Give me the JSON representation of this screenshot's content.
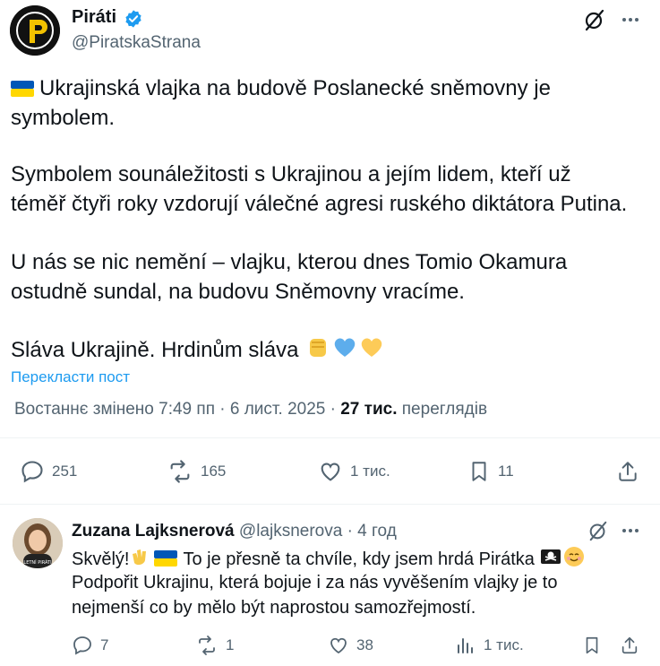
{
  "post": {
    "author_name": "Piráti",
    "author_handle": "@PiratskaStrana",
    "lines": [
      "Ukrajinská vlajka na budově Poslanecké sněmovny je",
      "symbolem.",
      "Symbolem sounáležitosti s Ukrajinou a jejím lidem, kteří už",
      "téměř čtyři roky vzdorují válečné agresi ruského diktátora Putina.",
      "U nás se nic nemění – vlajku, kterou dnes Tomio Okamura",
      "ostudně sundal, na budovu Sněmovny vracíme.",
      "Sláva Ukrajině. Hrdinům sláva"
    ],
    "translate_label": "Перекласти пост",
    "meta_prefix": "Востаннє змінено 7:49 пп · 6 лист. 2025 ·",
    "views_count": "27 тис.",
    "views_label": "переглядів",
    "actions": {
      "replies": "251",
      "reposts": "165",
      "likes": "1 тис.",
      "bookmarks": "11"
    }
  },
  "reply": {
    "author_name": "Zuzana Lajksnerová",
    "author_handle": "@lajksnerova · 4 год",
    "line1_a": "Skvělý!",
    "line1_b": "To je přesně ta chvíle, kdy jsem hrdá Pirátka",
    "line2": "Podpořit Ukrajinu, která bojuje i za nás vyvěšením vlajky je to",
    "line3": "nejmenší co by mělo být naprostou samozřejmostí.",
    "actions": {
      "replies": "7",
      "reposts": "1",
      "likes": "38",
      "views": "1 тис."
    }
  },
  "icons": {
    "verified": "verified-badge-icon",
    "grok": "grok-icon",
    "more": "more-icon",
    "reply": "reply-icon",
    "repost": "repost-icon",
    "like": "like-icon",
    "bookmark": "bookmark-icon",
    "share": "share-icon",
    "views": "views-icon"
  },
  "colors": {
    "link": "#1d9bf0",
    "secondary_text": "#536471",
    "primary_text": "#0f1419",
    "verified": "#1d9bf0",
    "flag_blue": "#0057b7",
    "flag_yellow": "#ffd700"
  }
}
